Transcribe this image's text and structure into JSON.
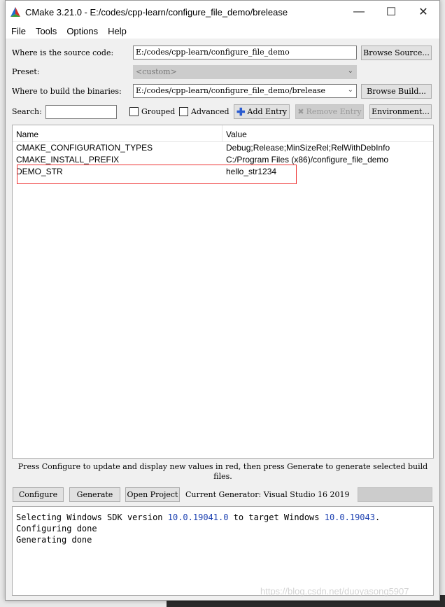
{
  "window": {
    "title": "CMake 3.21.0 - E:/codes/cpp-learn/configure_file_demo/brelease"
  },
  "menu": [
    "File",
    "Tools",
    "Options",
    "Help"
  ],
  "source": {
    "label": "Where is the source code:",
    "value": "E:/codes/cpp-learn/configure_file_demo",
    "browse": "Browse Source..."
  },
  "preset": {
    "label": "Preset:",
    "value": "<custom>"
  },
  "build": {
    "label": "Where to build the binaries:",
    "value": "E:/codes/cpp-learn/configure_file_demo/brelease",
    "browse": "Browse Build..."
  },
  "search": {
    "label": "Search:",
    "value": ""
  },
  "options": {
    "grouped": "Grouped",
    "advanced": "Advanced",
    "add_entry": "Add Entry",
    "remove_entry": "Remove Entry",
    "environment": "Environment..."
  },
  "table": {
    "headers": [
      "Name",
      "Value"
    ],
    "rows": [
      {
        "name": "CMAKE_CONFIGURATION_TYPES",
        "value": "Debug;Release;MinSizeRel;RelWithDebInfo"
      },
      {
        "name": "CMAKE_INSTALL_PREFIX",
        "value": "C:/Program Files (x86)/configure_file_demo"
      },
      {
        "name": "DEMO_STR",
        "value": "hello_str1234"
      }
    ]
  },
  "hint": "Press Configure to update and display new values in red, then press Generate to generate selected build files.",
  "actions": {
    "configure": "Configure",
    "generate": "Generate",
    "open_project": "Open Project",
    "generator": "Current Generator: Visual Studio 16 2019"
  },
  "log": {
    "l1a": "Selecting Windows SDK version ",
    "v1": "10.0.19041.0",
    "l1b": " to target Windows ",
    "v2": "10.0.19043",
    "l1c": ".",
    "l2": "Configuring done",
    "l3": "Generating done"
  },
  "watermark": "https://blog.csdn.net/duoyasong5907",
  "colors": {
    "highlight": "#e33333",
    "log_number": "#1a3fb0"
  }
}
